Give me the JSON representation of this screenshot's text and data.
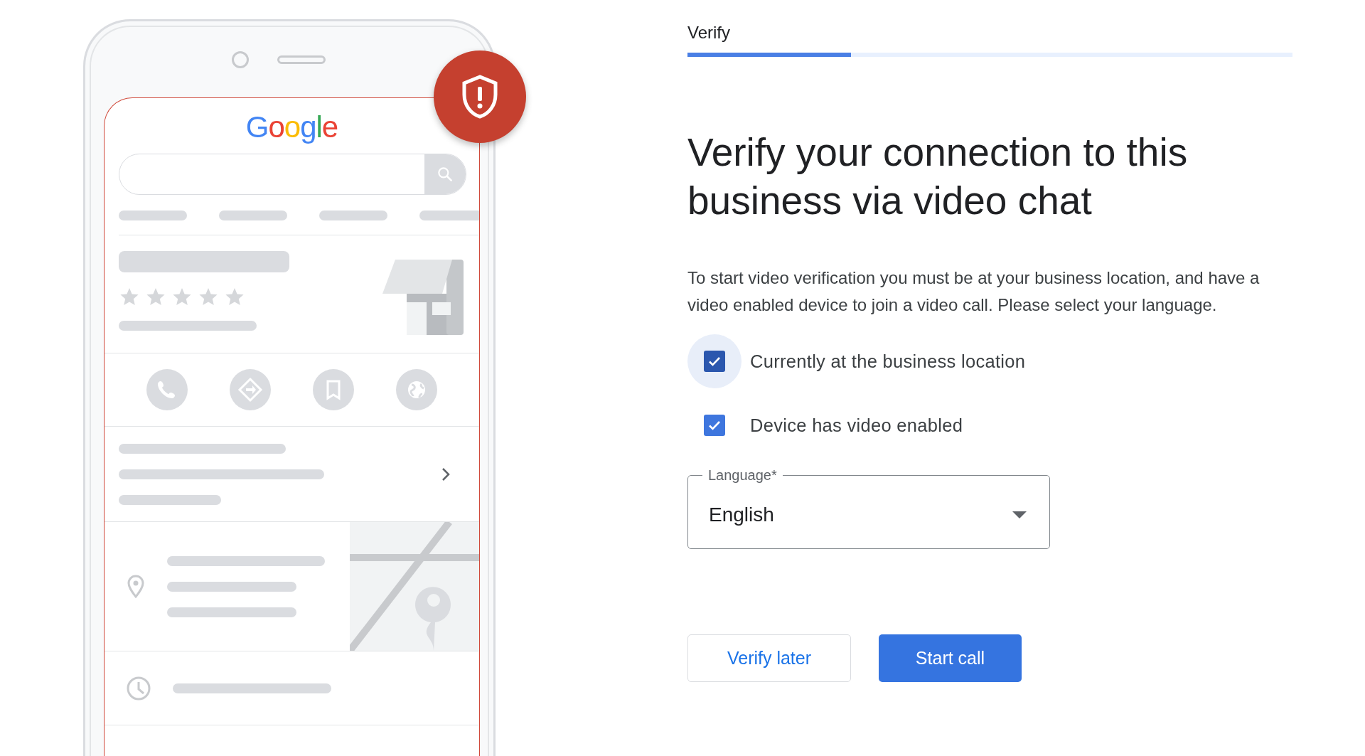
{
  "illustration": {
    "logo": "Google"
  },
  "step": {
    "title": "Verify",
    "level": 0.27
  },
  "heading": "Verify your connection to this business via video chat",
  "description": "To start video verification you must be at your business location, and have a video enabled device to join a video call. Please select your language.",
  "checkboxes": [
    {
      "label": "Currently at the business location",
      "checked": true,
      "focused": true
    },
    {
      "label": "Device has video enabled",
      "checked": true,
      "focused": false
    }
  ],
  "language_select": {
    "label": "Language*",
    "value": "English"
  },
  "buttons": [
    {
      "label": "Verify later",
      "kind": "outlined"
    },
    {
      "label": "Start call",
      "kind": "filled"
    }
  ]
}
